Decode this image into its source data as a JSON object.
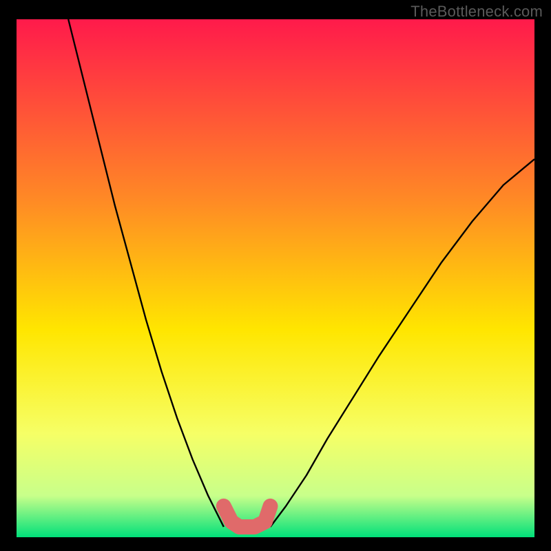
{
  "watermark": "TheBottleneck.com",
  "colors": {
    "background": "#000000",
    "gradient_top": "#ff1a4b",
    "gradient_mid1": "#ff8a25",
    "gradient_mid2": "#ffe600",
    "gradient_mid3": "#f6ff66",
    "gradient_low": "#c8ff8a",
    "gradient_bottom": "#00e07a",
    "curve": "#000000",
    "marker": "#e06a6a"
  },
  "chart_data": {
    "type": "line",
    "title": "",
    "xlabel": "",
    "ylabel": "",
    "xlim": [
      0,
      100
    ],
    "ylim": [
      0,
      100
    ],
    "grid": false,
    "legend": false,
    "background_gradient": {
      "orientation": "vertical",
      "stops": [
        {
          "offset": 0.0,
          "color": "#ff1a4b"
        },
        {
          "offset": 0.35,
          "color": "#ff8a25"
        },
        {
          "offset": 0.6,
          "color": "#ffe600"
        },
        {
          "offset": 0.8,
          "color": "#f6ff66"
        },
        {
          "offset": 0.92,
          "color": "#c8ff8a"
        },
        {
          "offset": 1.0,
          "color": "#00e07a"
        }
      ]
    },
    "series": [
      {
        "name": "left-curve",
        "stroke": "#000000",
        "stroke_width": 2.4,
        "x": [
          10,
          13,
          16,
          19,
          22,
          25,
          28,
          31,
          34,
          37,
          40
        ],
        "y": [
          100,
          88,
          76,
          64,
          53,
          42,
          32,
          23,
          15,
          8,
          2
        ]
      },
      {
        "name": "right-curve",
        "stroke": "#000000",
        "stroke_width": 2.4,
        "x": [
          49,
          52,
          56,
          60,
          65,
          70,
          76,
          82,
          88,
          94,
          100
        ],
        "y": [
          2,
          6,
          12,
          19,
          27,
          35,
          44,
          53,
          61,
          68,
          73
        ]
      },
      {
        "name": "optimal-marker",
        "stroke": "#e06a6a",
        "stroke_width": 22,
        "linecap": "round",
        "x": [
          40,
          41.5,
          43,
          46,
          48,
          49
        ],
        "y": [
          6,
          3,
          2,
          2,
          3,
          6
        ]
      }
    ],
    "annotations": []
  }
}
